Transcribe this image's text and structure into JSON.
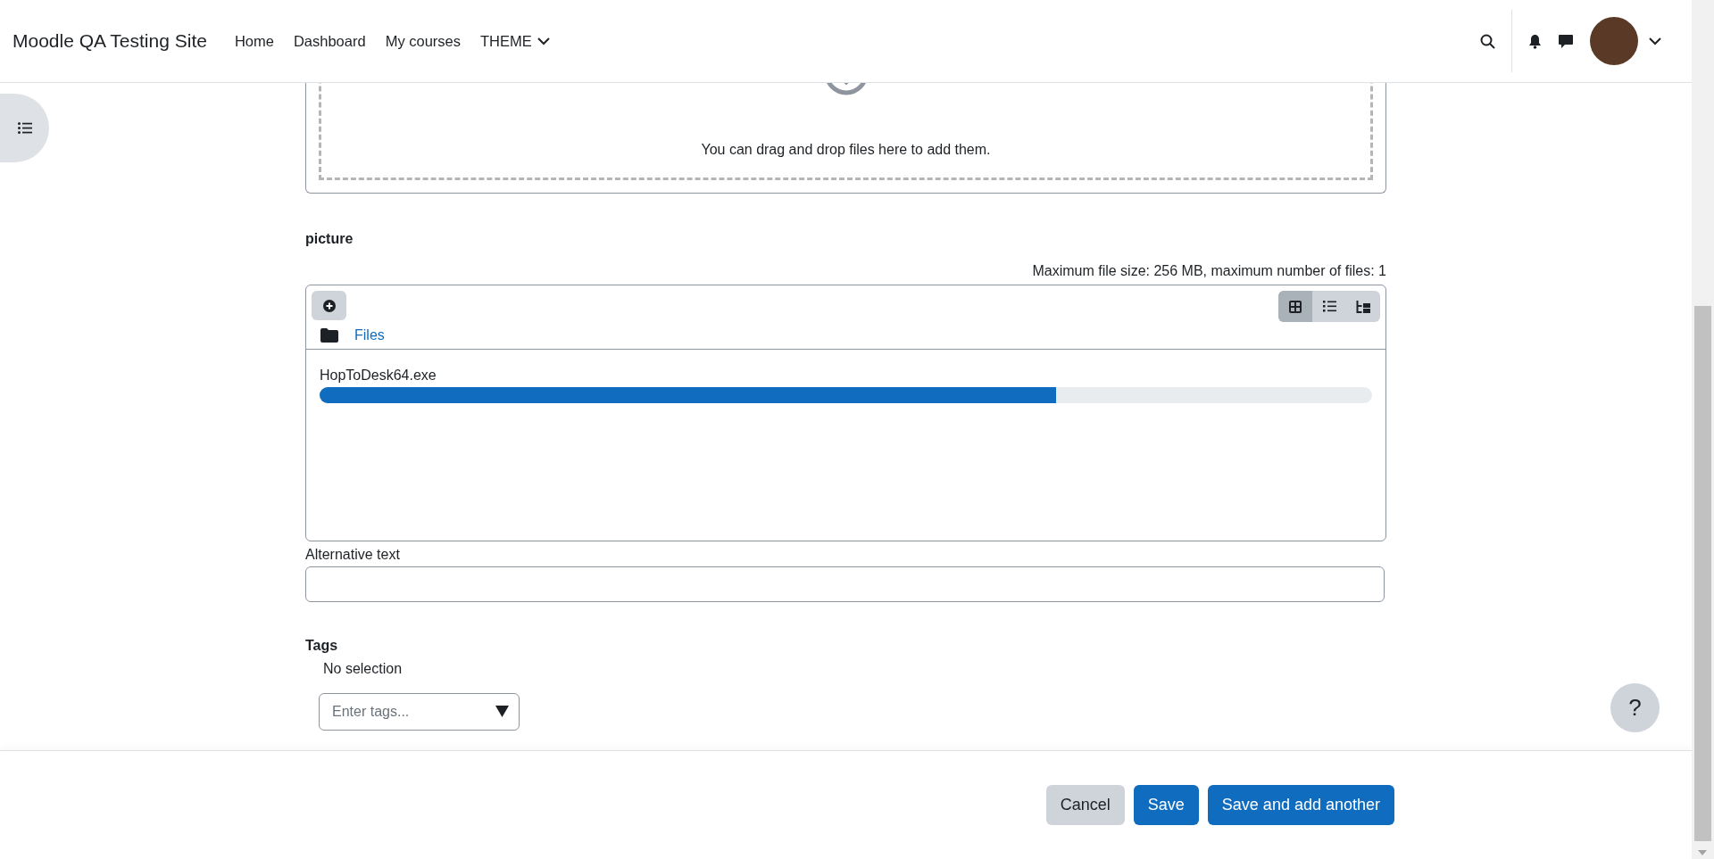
{
  "header": {
    "site_name": "Moodle QA Testing Site",
    "nav": [
      {
        "label": "Home",
        "kind": "link"
      },
      {
        "label": "Dashboard",
        "kind": "link"
      },
      {
        "label": "My courses",
        "kind": "link"
      },
      {
        "label": "THEME",
        "kind": "dropdown"
      }
    ]
  },
  "dropzone": {
    "message": "You can drag and drop files here to add them."
  },
  "picture_field": {
    "label": "picture",
    "limits": "Maximum file size: 256 MB, maximum number of files: 1",
    "path": "Files",
    "views": [
      {
        "kind": "icons",
        "selected": true
      },
      {
        "kind": "list",
        "selected": false
      },
      {
        "kind": "tree",
        "selected": false
      }
    ],
    "uploads": [
      {
        "name": "HopToDesk64.exe",
        "level": 0.7
      }
    ]
  },
  "alt_text": {
    "label": "Alternative text"
  },
  "tags": {
    "label": "Tags",
    "selection": "No selection",
    "placeholder": "Enter tags..."
  },
  "help": {
    "label": "?"
  },
  "footer": {
    "buttons": [
      {
        "label": "Cancel",
        "kind": "secondary"
      },
      {
        "label": "Save",
        "kind": "primary"
      },
      {
        "label": "Save and add another",
        "kind": "primary"
      }
    ]
  }
}
